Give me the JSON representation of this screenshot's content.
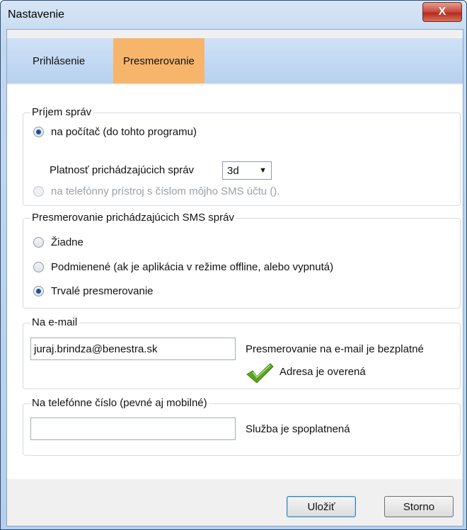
{
  "window": {
    "title": "Nastavenie",
    "close_label": "X"
  },
  "tabs": [
    {
      "label": "Prihlásenie",
      "active": false
    },
    {
      "label": "Presmerovanie",
      "active": true
    }
  ],
  "receive_group": {
    "legend": "Príjem správ",
    "opt_computer": "na počítač (do tohto programu)",
    "validity_label": "Platnosť prichádzajúcich správ",
    "validity_value": "3d",
    "opt_phone": "na telefónny prístroj s číslom môjho SMS účtu ()."
  },
  "redirect_group": {
    "legend": "Presmerovanie prichádzajúcich SMS správ",
    "opt_none": "Žiadne",
    "opt_conditional": "Podmienené (ak je aplikácia v režime offline, alebo vypnutá)",
    "opt_permanent": "Trvalé presmerovanie",
    "selected": "permanent"
  },
  "email_group": {
    "legend": "Na e-mail",
    "email_value": "juraj.brindza@benestra.sk",
    "free_note": "Presmerovanie na e-mail je bezplatné",
    "verified_note": "Adresa je overená"
  },
  "phone_group": {
    "legend": "Na telefónne číslo (pevné aj mobilné)",
    "phone_value": "",
    "paid_note": "Služba je spoplatnená"
  },
  "buttons": {
    "save": "Uložiť",
    "cancel": "Storno"
  },
  "colors": {
    "active_tab": "#f7b56c",
    "check_green": "#5aa520"
  }
}
